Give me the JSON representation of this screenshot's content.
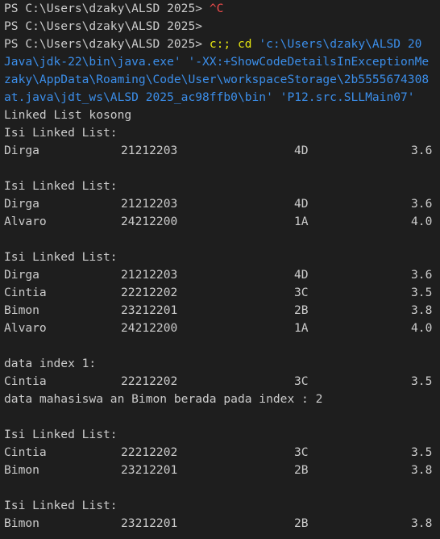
{
  "prompt": "PS C:\\Users\\dzaky\\ALSD 2025> ",
  "interrupt": "^C",
  "command": {
    "run": "c:; cd",
    "path_arg": "'c:\\Users\\dzaky\\ALSD 20",
    "line2_a": "Java\\jdk-22\\bin\\java.exe'",
    "line2_b": " '-XX:+ShowCodeDetailsInExceptionMe",
    "line3": "zaky\\AppData\\Roaming\\Code\\User\\workspaceStorage\\2b5555674308",
    "line4": "at.java\\jdt_ws\\ALSD 2025_ac98ffb0\\bin' 'P12.src.SLLMain07'"
  },
  "output": {
    "empty_msg": "Linked List kosong",
    "list_header": "Isi Linked List:",
    "index_label": "data index 1:",
    "search_msg": "data mahasiswa an Bimon berada pada index : 2"
  },
  "blocks": {
    "b1": [
      {
        "name": "Dirga",
        "nim": "21212203",
        "kelas": "4D",
        "ipk": "3.6"
      }
    ],
    "b2": [
      {
        "name": "Dirga",
        "nim": "21212203",
        "kelas": "4D",
        "ipk": "3.6"
      },
      {
        "name": "Alvaro",
        "nim": "24212200",
        "kelas": "1A",
        "ipk": "4.0"
      }
    ],
    "b3": [
      {
        "name": "Dirga",
        "nim": "21212203",
        "kelas": "4D",
        "ipk": "3.6"
      },
      {
        "name": "Cintia",
        "nim": "22212202",
        "kelas": "3C",
        "ipk": "3.5"
      },
      {
        "name": "Bimon",
        "nim": "23212201",
        "kelas": "2B",
        "ipk": "3.8"
      },
      {
        "name": "Alvaro",
        "nim": "24212200",
        "kelas": "1A",
        "ipk": "4.0"
      }
    ],
    "b4": [
      {
        "name": "Cintia",
        "nim": "22212202",
        "kelas": "3C",
        "ipk": "3.5"
      }
    ],
    "b5": [
      {
        "name": "Cintia",
        "nim": "22212202",
        "kelas": "3C",
        "ipk": "3.5"
      },
      {
        "name": "Bimon",
        "nim": "23212201",
        "kelas": "2B",
        "ipk": "3.8"
      }
    ],
    "b6": [
      {
        "name": "Bimon",
        "nim": "23212201",
        "kelas": "2B",
        "ipk": "3.8"
      }
    ]
  }
}
